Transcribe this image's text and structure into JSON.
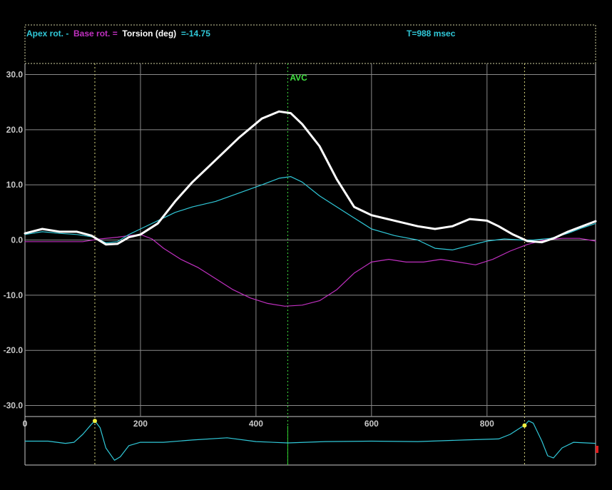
{
  "header": {
    "apex_label": "Apex rot. -",
    "base_label": "Base rot. =",
    "torsion_label": "Torsion (deg)",
    "value_text": "=-14.75",
    "period_text": "T=988 msec"
  },
  "chart_data": {
    "type": "line",
    "xlim": [
      0,
      988
    ],
    "ylim": [
      -32,
      32
    ],
    "x_ticks": [
      0,
      200,
      400,
      600,
      800
    ],
    "x_tick_labels": [
      "0",
      "200",
      "400",
      "600",
      "800"
    ],
    "y_ticks": [
      30,
      20,
      10,
      0,
      -10,
      -20,
      -30
    ],
    "y_tick_labels": [
      "30.0",
      "20.0",
      "10.0",
      "0.0",
      "-10.0",
      "-20.0",
      "-30.0"
    ],
    "grid": true,
    "markers": [
      {
        "x": 121,
        "style": "dotted",
        "color": "#d8d880",
        "label": ""
      },
      {
        "x": 455,
        "style": "dotted",
        "color": "#40e040",
        "label": "AVC"
      },
      {
        "x": 865,
        "style": "dotted",
        "color": "#d8d880",
        "label": ""
      }
    ],
    "series": [
      {
        "id": "torsion",
        "color": "#ffffff",
        "points": [
          [
            0,
            1.2
          ],
          [
            30,
            2.0
          ],
          [
            60,
            1.5
          ],
          [
            90,
            1.5
          ],
          [
            115,
            0.8
          ],
          [
            140,
            -0.8
          ],
          [
            160,
            -0.7
          ],
          [
            180,
            0.5
          ],
          [
            200,
            1.0
          ],
          [
            230,
            3.0
          ],
          [
            260,
            7.0
          ],
          [
            290,
            10.5
          ],
          [
            330,
            14.5
          ],
          [
            370,
            18.5
          ],
          [
            410,
            22.0
          ],
          [
            440,
            23.3
          ],
          [
            460,
            23.0
          ],
          [
            480,
            21.0
          ],
          [
            510,
            17.0
          ],
          [
            540,
            11.0
          ],
          [
            570,
            6.0
          ],
          [
            600,
            4.5
          ],
          [
            640,
            3.5
          ],
          [
            680,
            2.5
          ],
          [
            710,
            2.0
          ],
          [
            740,
            2.5
          ],
          [
            770,
            3.8
          ],
          [
            800,
            3.5
          ],
          [
            820,
            2.5
          ],
          [
            845,
            1.0
          ],
          [
            870,
            -0.2
          ],
          [
            895,
            -0.4
          ],
          [
            915,
            0.3
          ],
          [
            940,
            1.5
          ],
          [
            965,
            2.5
          ],
          [
            988,
            3.4
          ]
        ]
      },
      {
        "id": "apex",
        "color": "#30c8d8",
        "points": [
          [
            0,
            1.0
          ],
          [
            30,
            1.5
          ],
          [
            60,
            1.2
          ],
          [
            90,
            1.0
          ],
          [
            120,
            0.5
          ],
          [
            140,
            -0.5
          ],
          [
            160,
            -0.3
          ],
          [
            180,
            1.0
          ],
          [
            200,
            2.0
          ],
          [
            230,
            3.5
          ],
          [
            260,
            5.0
          ],
          [
            290,
            6.0
          ],
          [
            330,
            7.0
          ],
          [
            370,
            8.5
          ],
          [
            410,
            10.0
          ],
          [
            440,
            11.2
          ],
          [
            460,
            11.5
          ],
          [
            480,
            10.5
          ],
          [
            510,
            8.0
          ],
          [
            540,
            6.0
          ],
          [
            570,
            4.0
          ],
          [
            600,
            2.0
          ],
          [
            640,
            0.8
          ],
          [
            680,
            0.0
          ],
          [
            710,
            -1.5
          ],
          [
            740,
            -1.8
          ],
          [
            770,
            -1.0
          ],
          [
            800,
            -0.2
          ],
          [
            830,
            0.2
          ],
          [
            860,
            0.0
          ],
          [
            880,
            0.0
          ],
          [
            910,
            0.3
          ],
          [
            940,
            1.2
          ],
          [
            965,
            2.2
          ],
          [
            988,
            3.0
          ]
        ]
      },
      {
        "id": "base",
        "color": "#c030c0",
        "points": [
          [
            0,
            -0.3
          ],
          [
            60,
            -0.3
          ],
          [
            100,
            -0.3
          ],
          [
            130,
            0.2
          ],
          [
            160,
            0.5
          ],
          [
            180,
            0.8
          ],
          [
            200,
            1.0
          ],
          [
            220,
            0.2
          ],
          [
            240,
            -1.5
          ],
          [
            270,
            -3.5
          ],
          [
            300,
            -5.0
          ],
          [
            330,
            -7.0
          ],
          [
            360,
            -9.0
          ],
          [
            390,
            -10.5
          ],
          [
            420,
            -11.5
          ],
          [
            450,
            -12.0
          ],
          [
            480,
            -11.8
          ],
          [
            510,
            -11.0
          ],
          [
            540,
            -9.0
          ],
          [
            570,
            -6.0
          ],
          [
            600,
            -4.0
          ],
          [
            630,
            -3.5
          ],
          [
            660,
            -4.0
          ],
          [
            690,
            -4.0
          ],
          [
            720,
            -3.5
          ],
          [
            750,
            -4.0
          ],
          [
            780,
            -4.5
          ],
          [
            810,
            -3.5
          ],
          [
            840,
            -2.0
          ],
          [
            870,
            -0.8
          ],
          [
            900,
            0.0
          ],
          [
            930,
            0.3
          ],
          [
            960,
            0.3
          ],
          [
            988,
            -0.2
          ]
        ]
      }
    ],
    "ecg": {
      "color": "#30c8d8",
      "range": [
        -1,
        1
      ],
      "points": [
        [
          0,
          0
        ],
        [
          40,
          0
        ],
        [
          70,
          -0.1
        ],
        [
          85,
          -0.05
        ],
        [
          100,
          0.3
        ],
        [
          115,
          0.75
        ],
        [
          121,
          0.9
        ],
        [
          130,
          0.6
        ],
        [
          140,
          -0.3
        ],
        [
          155,
          -0.85
        ],
        [
          165,
          -0.7
        ],
        [
          180,
          -0.2
        ],
        [
          200,
          -0.05
        ],
        [
          240,
          -0.05
        ],
        [
          290,
          0.05
        ],
        [
          350,
          0.15
        ],
        [
          400,
          -0.02
        ],
        [
          455,
          -0.08
        ],
        [
          520,
          -0.02
        ],
        [
          600,
          0.0
        ],
        [
          680,
          -0.02
        ],
        [
          760,
          0.05
        ],
        [
          820,
          0.1
        ],
        [
          840,
          0.3
        ],
        [
          858,
          0.6
        ],
        [
          865,
          0.7
        ],
        [
          872,
          0.9
        ],
        [
          880,
          0.8
        ],
        [
          895,
          0.0
        ],
        [
          905,
          -0.65
        ],
        [
          915,
          -0.75
        ],
        [
          930,
          -0.3
        ],
        [
          950,
          -0.05
        ],
        [
          988,
          -0.1
        ]
      ],
      "markers": [
        [
          121,
          0.9
        ],
        [
          865,
          0.7
        ]
      ],
      "green_marker_x": 455
    }
  }
}
